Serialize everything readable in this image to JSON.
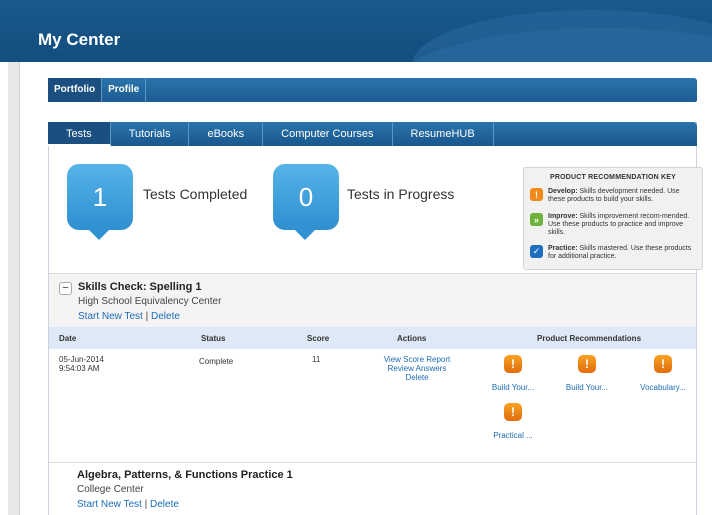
{
  "header": {
    "title": "My Center"
  },
  "subnav": {
    "items": [
      "Portfolio",
      "Profile"
    ]
  },
  "tabs": [
    "Tests",
    "Tutorials",
    "eBooks",
    "Computer Courses",
    "ResumeHUB"
  ],
  "stats": {
    "completed": {
      "count": "1",
      "label": "Tests Completed"
    },
    "in_progress": {
      "count": "0",
      "label": "Tests in Progress"
    }
  },
  "key": {
    "title": "PRODUCT RECOMMENDATION KEY",
    "develop": {
      "label": "Develop:",
      "text": "Skills development needed. Use these products to build your skills."
    },
    "improve": {
      "label": "Improve:",
      "text": "Skills improvement recom-mended. Use these products to practice and improve skills."
    },
    "practice": {
      "label": "Practice:",
      "text": "Skills mastered. Use these products for additional practice."
    }
  },
  "test1": {
    "title": "Skills Check: Spelling 1",
    "center": "High School Equivalency Center",
    "start": "Start New Test",
    "sep": "|",
    "delete": "Delete"
  },
  "table": {
    "headers": {
      "date": "Date",
      "status": "Status",
      "score": "Score",
      "actions": "Actions",
      "recs": "Product Recommendations"
    },
    "row": {
      "date": "05-Jun-2014",
      "time": "9:54:03 AM",
      "status": "Complete",
      "score": "11",
      "actions": [
        "View Score Report",
        "Review Answers",
        "Delete"
      ],
      "recs": [
        "Build Your...",
        "Build Your...",
        "Vocabulary...",
        "Practical ..."
      ]
    }
  },
  "test2": {
    "title": "Algebra, Patterns, & Functions Practice 1",
    "center": "College Center",
    "start": "Start New Test",
    "sep": "|",
    "delete": "Delete"
  },
  "icons": {
    "develop": "!",
    "improve": "»",
    "practice": "✓",
    "collapse": "−"
  },
  "colors": {
    "header": "#1a5a8e",
    "accent": "#2b74ad",
    "warn": "#f08a1a",
    "improve": "#6fb23b",
    "practice": "#1f6fbf",
    "link": "#1c6cb6"
  }
}
